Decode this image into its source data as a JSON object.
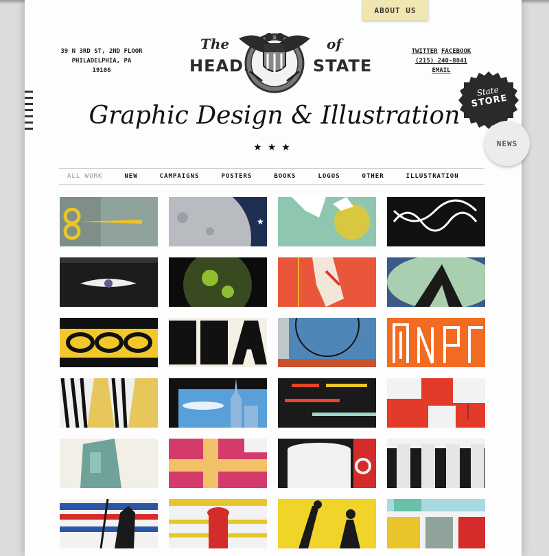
{
  "header": {
    "about_label": "ABOUT US",
    "address": [
      "39 N 3RD ST, 2ND FLOOR",
      "PHILADELPHIA, PA",
      "19106"
    ],
    "contact": {
      "twitter": "TWITTER",
      "facebook": "FACEBOOK",
      "phone": "(215) 240-8841",
      "email": "EMAIL"
    },
    "logo": {
      "the": "The",
      "of": "of",
      "heads": "HEADS",
      "state": "STATE"
    },
    "tagline": "Graphic Design & Illustration",
    "stars": "★★★"
  },
  "badges": {
    "store_top": "State",
    "store_bottom": "STORE",
    "news": "NEWS"
  },
  "nav": {
    "items": [
      "ALL WORK",
      "NEW",
      "CAMPAIGNS",
      "POSTERS",
      "BOOKS",
      "LOGOS",
      "OTHER",
      "ILLUSTRATION"
    ]
  },
  "colors": {
    "page_bg": "#dcdcdc",
    "paper": "#fdfdfd",
    "about_tab": "#efe6b2",
    "store_badge": "#2a2a2a",
    "news_badge": "#ececec"
  },
  "portfolio": {
    "tiles": [
      "scissors",
      "moon-night",
      "dove-sun",
      "black-pattern",
      "eye",
      "green-moon",
      "sneaker",
      "leaf",
      "chain",
      "bra-letters",
      "blue-circle",
      "orange-letters",
      "zebra",
      "city-skyline",
      "stripes",
      "red-white-blocks",
      "green-hand",
      "pink-tape",
      "coffee-cup",
      "columns",
      "umbrella-figure",
      "hydrant",
      "walking-figures",
      "color-blocks"
    ]
  }
}
